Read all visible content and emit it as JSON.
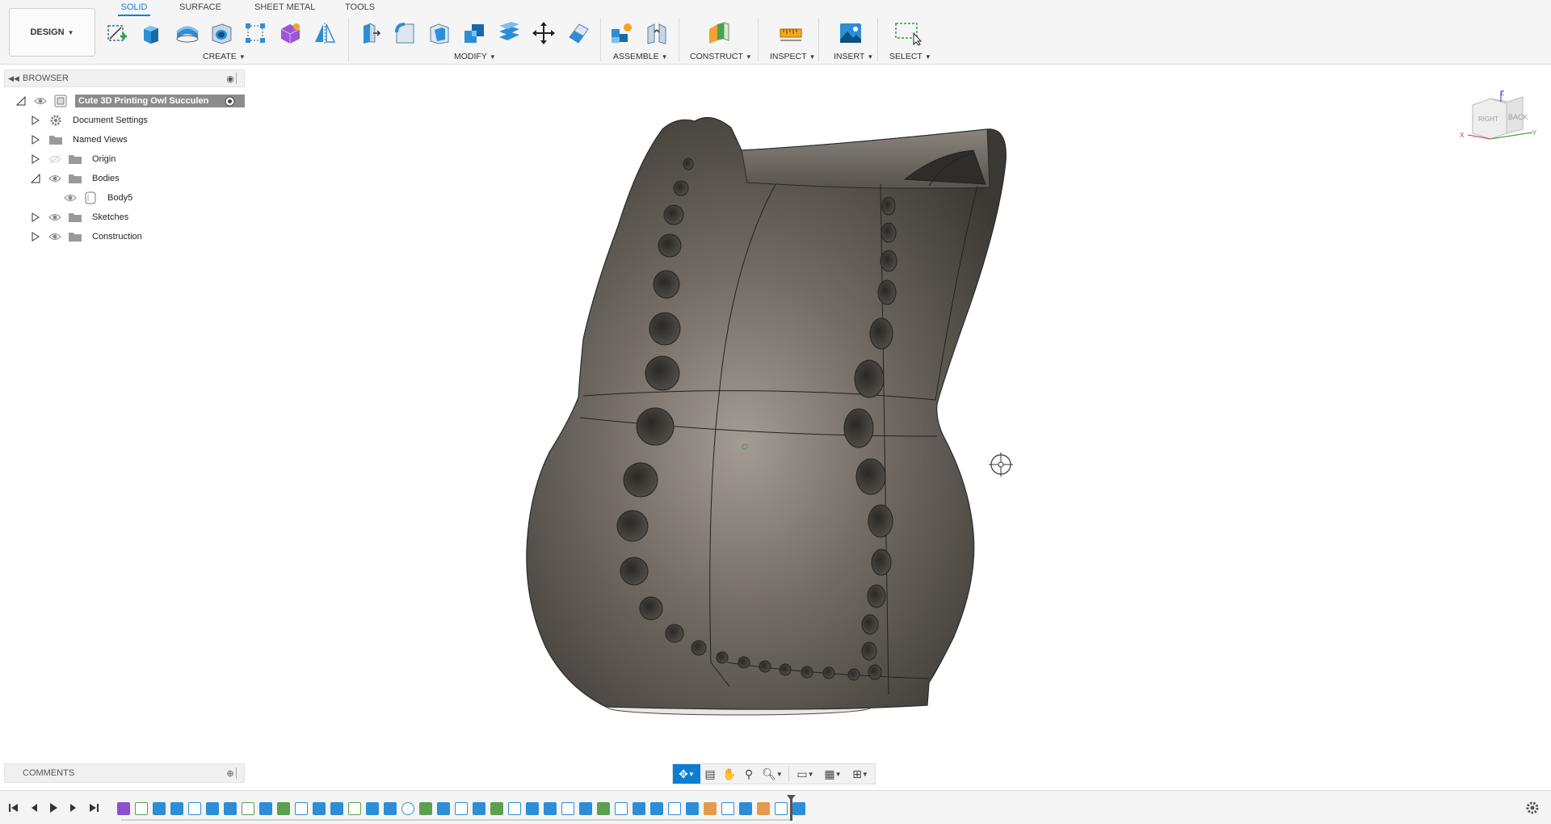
{
  "app": {
    "workspace_label": "DESIGN",
    "tabs": [
      "SOLID",
      "SURFACE",
      "SHEET METAL",
      "TOOLS"
    ],
    "active_tab": "SOLID"
  },
  "toolbar": {
    "groups": {
      "create": "CREATE",
      "modify": "MODIFY",
      "assemble": "ASSEMBLE",
      "construct": "CONSTRUCT",
      "inspect": "INSPECT",
      "insert": "INSERT",
      "select": "SELECT"
    },
    "icons": {
      "create": [
        "create-sketch-icon",
        "extrude-icon",
        "revolve-icon",
        "hole-icon",
        "rectangular-pattern-icon",
        "form-icon",
        "mirror-icon"
      ],
      "modify": [
        "press-pull-icon",
        "fillet-icon",
        "shell-icon",
        "combine-icon",
        "offset-face-icon",
        "move-icon",
        "split-face-icon"
      ],
      "assemble": [
        "new-component-icon",
        "joint-icon"
      ],
      "construct": [
        "offset-plane-icon"
      ],
      "inspect": [
        "measure-icon"
      ],
      "insert": [
        "insert-image-icon"
      ],
      "select": [
        "select-window-icon"
      ]
    }
  },
  "browser": {
    "title": "BROWSER",
    "root": "Cute 3D Printing Owl Succulen",
    "items": [
      {
        "label": "Document Settings",
        "icon": "gear-icon"
      },
      {
        "label": "Named Views",
        "icon": "folder-icon"
      },
      {
        "label": "Origin",
        "icon": "folder-icon"
      },
      {
        "label": "Bodies",
        "icon": "folder-icon"
      },
      {
        "label": "Body5",
        "icon": "body-icon"
      },
      {
        "label": "Sketches",
        "icon": "folder-icon"
      },
      {
        "label": "Construction",
        "icon": "folder-icon"
      }
    ]
  },
  "viewcube": {
    "faces": [
      "RIGHT",
      "BACK"
    ],
    "axes": [
      "X",
      "Y",
      "Z"
    ]
  },
  "comments": {
    "title": "COMMENTS"
  },
  "colors": {
    "accent": "#0b7ed2",
    "model": "#6b6660",
    "toolbar_bg": "#f5f5f5"
  }
}
